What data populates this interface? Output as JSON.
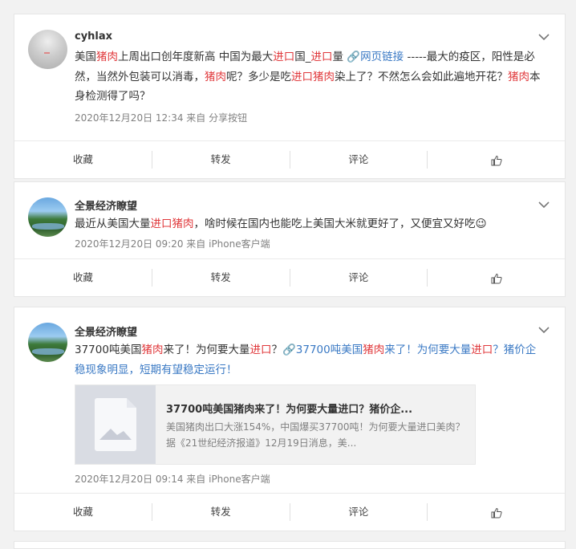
{
  "posts": [
    {
      "name": "cyhlax",
      "segments": [
        {
          "t": "美国",
          "c": ""
        },
        {
          "t": "猪肉",
          "c": "red"
        },
        {
          "t": "上周出口创年度新高 中国为最大",
          "c": ""
        },
        {
          "t": "进口",
          "c": "red"
        },
        {
          "t": "国_",
          "c": ""
        },
        {
          "t": "进口",
          "c": "red"
        },
        {
          "t": "量 ",
          "c": ""
        },
        {
          "t": "🔗网页链接",
          "c": "link"
        },
        {
          "t": " -----最大的疫区，阳性是必然，当然外包装可以消毒，",
          "c": ""
        },
        {
          "t": "猪肉",
          "c": "red"
        },
        {
          "t": "呢？多少是吃",
          "c": ""
        },
        {
          "t": "进口猪肉",
          "c": "red"
        },
        {
          "t": "染上了？不然怎么会如此遍地开花？",
          "c": ""
        },
        {
          "t": "猪肉",
          "c": "red"
        },
        {
          "t": "本身检测得了吗？",
          "c": ""
        }
      ],
      "meta": "2020年12月20日 12:34  来自 分享按钮"
    },
    {
      "name": "全景经济瞭望",
      "segments": [
        {
          "t": "最近从美国大量",
          "c": ""
        },
        {
          "t": "进口猪肉",
          "c": "red"
        },
        {
          "t": "，啥时候在国内也能吃上美国大米就更好了，又便宜又好吃😉",
          "c": ""
        }
      ],
      "meta": "2020年12月20日 09:20  来自 iPhone客户端"
    },
    {
      "name": "全景经济瞭望",
      "segments": [
        {
          "t": "37700吨美国",
          "c": ""
        },
        {
          "t": "猪肉",
          "c": "red"
        },
        {
          "t": "来了！为何要大量",
          "c": ""
        },
        {
          "t": "进口",
          "c": "red"
        },
        {
          "t": "？",
          "c": ""
        },
        {
          "t": "🔗37700吨美国",
          "c": "link"
        },
        {
          "t": "猪肉",
          "c": "red"
        },
        {
          "t": "来了！为何要大量",
          "c": "link"
        },
        {
          "t": "进口",
          "c": "red"
        },
        {
          "t": "？猪价企稳现象明显，短期有望稳定运行！",
          "c": "link"
        }
      ],
      "link_card": {
        "title": "37700吨美国猪肉来了！为何要大量进口？猪价企...",
        "desc": "美国猪肉出口大涨154%，中国爆买37700吨！为何要大量进口美肉？据《21世纪经济报道》12月19日消息，美..."
      },
      "meta": "2020年12月20日 09:14  来自 iPhone客户端"
    }
  ],
  "actions": {
    "collect": "收藏",
    "repost": "转发",
    "comment": "评论"
  },
  "icons": {
    "chevron": "chevron-down-icon",
    "like": "thumbs-up-icon",
    "link": "link-icon"
  },
  "colors": {
    "highlight": "#e0383b",
    "link": "#3a79c4",
    "meta": "#808080"
  }
}
